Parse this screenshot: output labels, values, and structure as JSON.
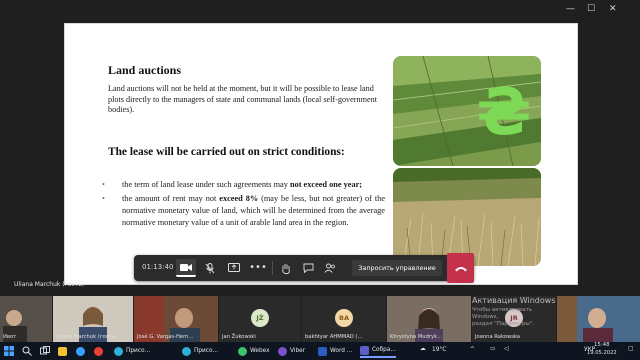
{
  "window": {
    "controls": [
      "minimize-icon",
      "maximize-icon",
      "close-icon"
    ]
  },
  "slide": {
    "title": "Land auctions",
    "intro": "Land auctions will not be held at the moment, but it will be possible to lease land plots directly to the managers of state and communal lands (local self-government bodies).",
    "subtitle": "The lease will be carried out on strict conditions:",
    "bullet1_a": "the term of land lease under such agreements may ",
    "bullet1_b": "not exceed one year;",
    "bullet2_a": "the amount of rent may not ",
    "bullet2_b": "exceed 8%",
    "bullet2_c": " (may be less, but not greater) of the normative monetary value of land, which will be determined from the average normative monetary value of a unit of arable land area in the region.",
    "currency_symbol": "₴",
    "images": [
      "farm-fields-image",
      "wild-grass-field-image"
    ],
    "accent_color": "#7ed957"
  },
  "presenter": {
    "name": "Uliana Marchuk (гость)"
  },
  "callbar": {
    "timer": "01:13:40",
    "take_control_label": "Запросить управление",
    "buttons": [
      "camera-icon",
      "mic-off-icon",
      "share-screen-icon",
      "more-icon",
      "raise-hand-icon",
      "chat-icon",
      "participants-icon",
      "hang-up-icon"
    ],
    "hangup_color": "#c4314b"
  },
  "participants": [
    {
      "label": "Ивот",
      "type": "video"
    },
    {
      "label": "Uliana Marchuk (гость)",
      "type": "video"
    },
    {
      "label": "José G. Vargas-Hern...",
      "type": "video"
    },
    {
      "label": "Jan Žukowski",
      "type": "avatar",
      "initials": "JŽ",
      "color": "#dbe8c8"
    },
    {
      "label": "bakhtyar AHMMAD (...",
      "type": "avatar",
      "initials": "BA",
      "color": "#f1d8a5"
    },
    {
      "label": "Khrystyna Mudryk...",
      "type": "video"
    },
    {
      "label": "Joanna Rakowska",
      "type": "avatar",
      "initials": "JR",
      "color": "#d9c6c6"
    },
    {
      "label": "",
      "type": "video"
    }
  ],
  "activation": {
    "title": "Активация Windows",
    "line1": "Чтобы активировать Windows,",
    "line2": "раздел \"Параметры\"."
  },
  "taskbar": {
    "items": [
      {
        "label": "",
        "icon": "windows-start-icon",
        "color": "#4aa3ff"
      },
      {
        "label": "",
        "icon": "search-icon",
        "color": "#e6e6e6"
      },
      {
        "label": "",
        "icon": "task-view-icon",
        "color": "#e6e6e6"
      },
      {
        "label": "",
        "icon": "folder-icon",
        "color": "#f2c230"
      },
      {
        "label": "",
        "icon": "browser-icon",
        "color": "#3aa0ff"
      },
      {
        "label": "",
        "icon": "chrome-icon",
        "color": "#e94235"
      },
      {
        "label": "Присо...",
        "icon": "edge-icon",
        "color": "#2fb1d7"
      },
      {
        "label": "Присо...",
        "icon": "edge-icon",
        "color": "#2fb1d7"
      },
      {
        "label": "Webex",
        "icon": "webex-icon",
        "color": "#39c36d"
      },
      {
        "label": "Viber",
        "icon": "viber-icon",
        "color": "#7b53c8"
      },
      {
        "label": "Word ...",
        "icon": "word-icon",
        "color": "#2b5cbf"
      },
      {
        "label": "Собра...",
        "icon": "teams-icon",
        "color": "#5b5fc7"
      }
    ],
    "temperature": "19°C",
    "language": "УКР",
    "time": "15:48",
    "date": "19.05.2022"
  }
}
